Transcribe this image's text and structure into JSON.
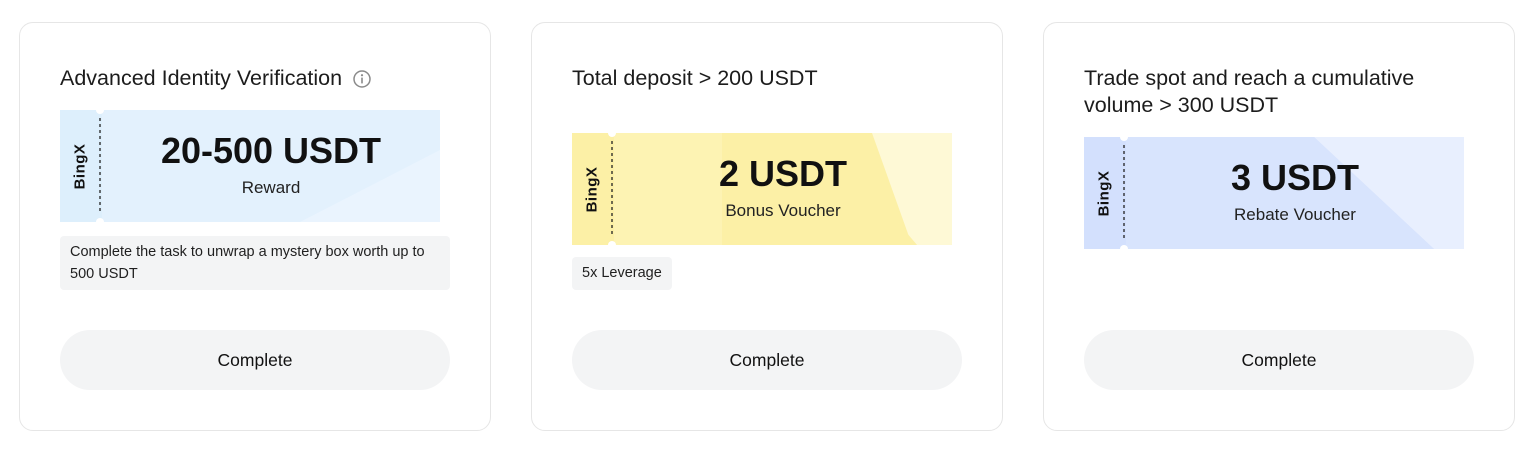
{
  "cards": [
    {
      "title": "Advanced Identity Verification",
      "info_icon": "info-circle-icon",
      "ticket": {
        "brand": "BingX",
        "amount": "20-500 USDT",
        "label": "Reward",
        "color": "#dceefc",
        "color_light": "#eaf4fe"
      },
      "note": "Complete the task to unwrap a mystery box worth up to 500 USDT",
      "button_label": "Complete"
    },
    {
      "title": "Total deposit > 200 USDT",
      "ticket": {
        "brand": "BingX",
        "amount": "2 USDT",
        "label": "Bonus Voucher",
        "color": "#fcef9c",
        "color_light": "#fef8d0"
      },
      "tag": "5x Leverage",
      "button_label": "Complete"
    },
    {
      "title": "Trade spot and reach a cumulative volume > 300 USDT",
      "ticket": {
        "brand": "BingX",
        "amount": "3 USDT",
        "label": "Rebate Voucher",
        "color": "#d3e0fd",
        "color_light": "#e6eefe"
      },
      "button_label": "Complete"
    }
  ]
}
